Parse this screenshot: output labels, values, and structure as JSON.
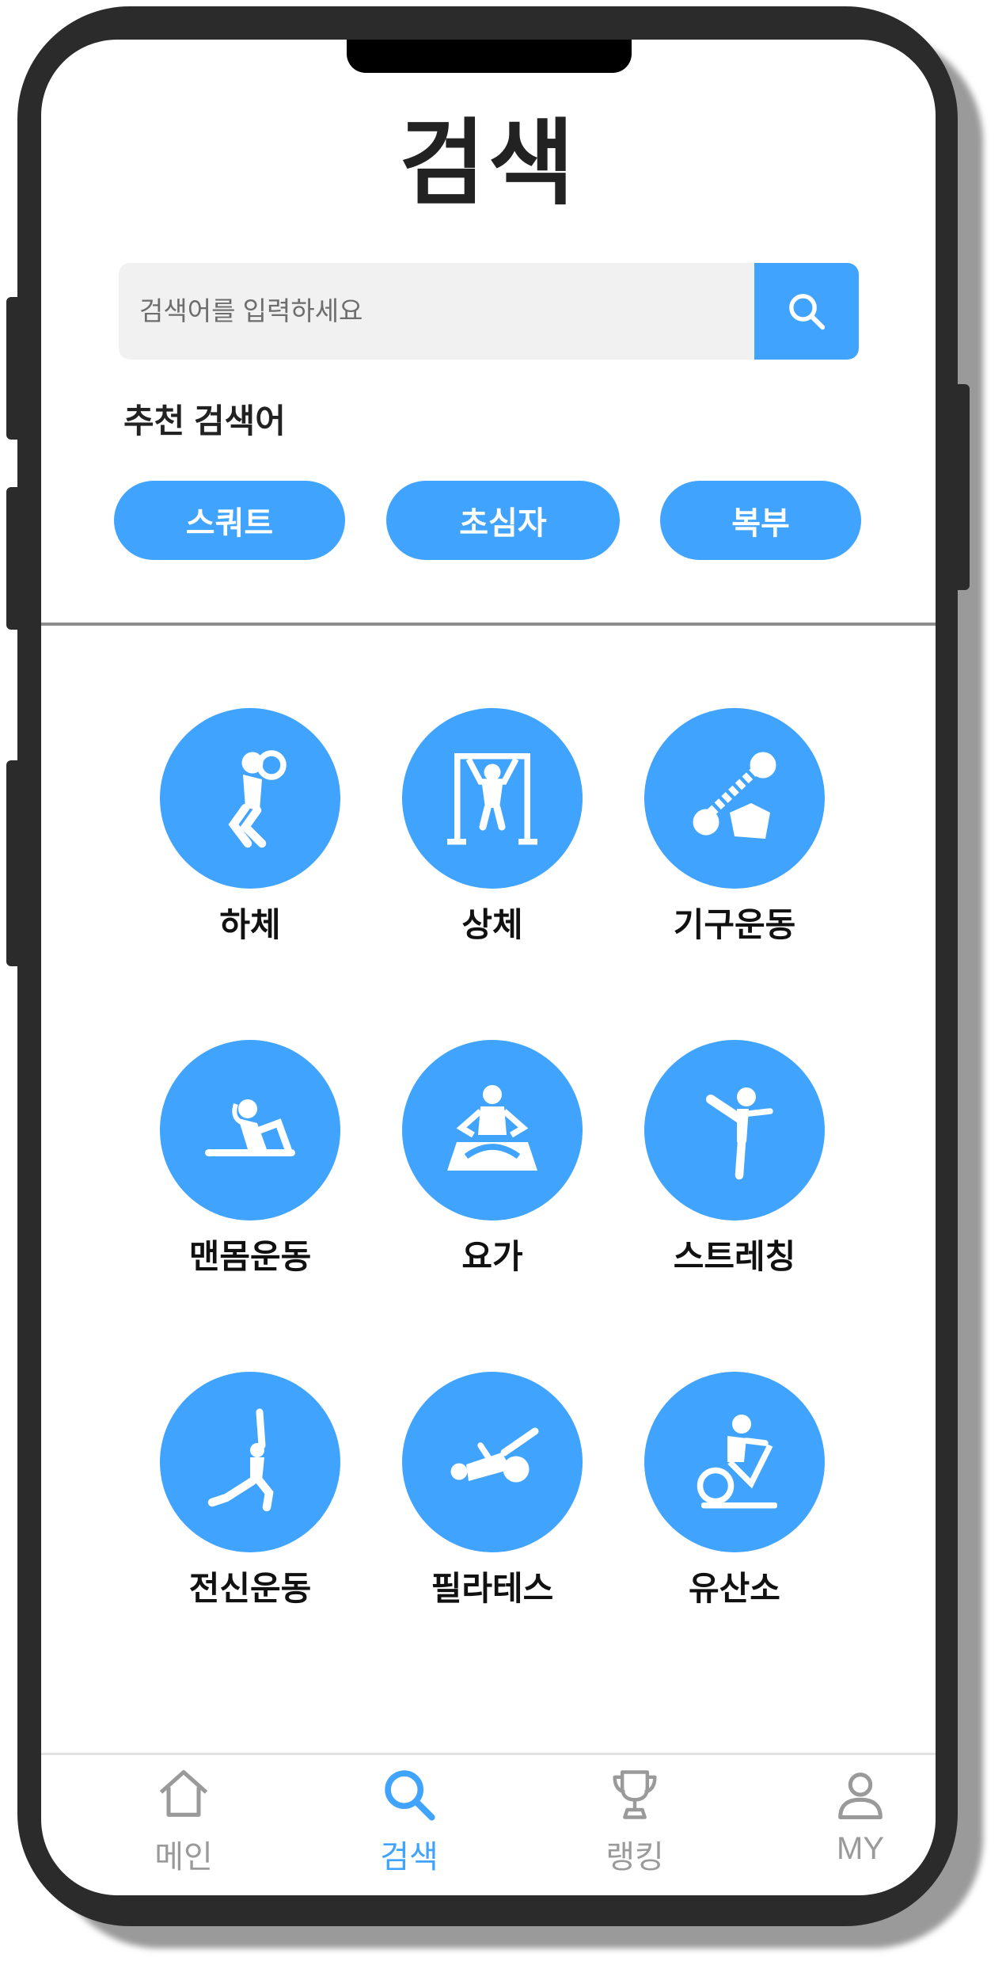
{
  "header": {
    "title": "검색"
  },
  "search": {
    "placeholder": "검색어를 입력하세요",
    "button_icon": "search-icon"
  },
  "recommended": {
    "title": "추천 검색어",
    "chips": [
      "스쿼트",
      "초심자",
      "복부"
    ]
  },
  "categories": [
    {
      "label": "하체",
      "icon": "squat-icon"
    },
    {
      "label": "상체",
      "icon": "pullup-icon"
    },
    {
      "label": "기구운동",
      "icon": "dumbbell-icon"
    },
    {
      "label": "맨몸운동",
      "icon": "situp-icon"
    },
    {
      "label": "요가",
      "icon": "meditation-icon"
    },
    {
      "label": "스트레칭",
      "icon": "stretch-kick-icon"
    },
    {
      "label": "전신운동",
      "icon": "lunge-stretch-icon"
    },
    {
      "label": "필라테스",
      "icon": "pilates-icon"
    },
    {
      "label": "유산소",
      "icon": "exercise-bike-icon"
    }
  ],
  "tabbar": {
    "items": [
      {
        "label": "메인",
        "icon": "home-icon"
      },
      {
        "label": "검색",
        "icon": "search-icon",
        "active": true
      },
      {
        "label": "랭킹",
        "icon": "trophy-icon"
      },
      {
        "label": "MY",
        "icon": "user-icon"
      }
    ]
  },
  "colors": {
    "accent": "#40a4ff",
    "inactive": "#9a9a9a",
    "frame": "#2b2b2b"
  }
}
